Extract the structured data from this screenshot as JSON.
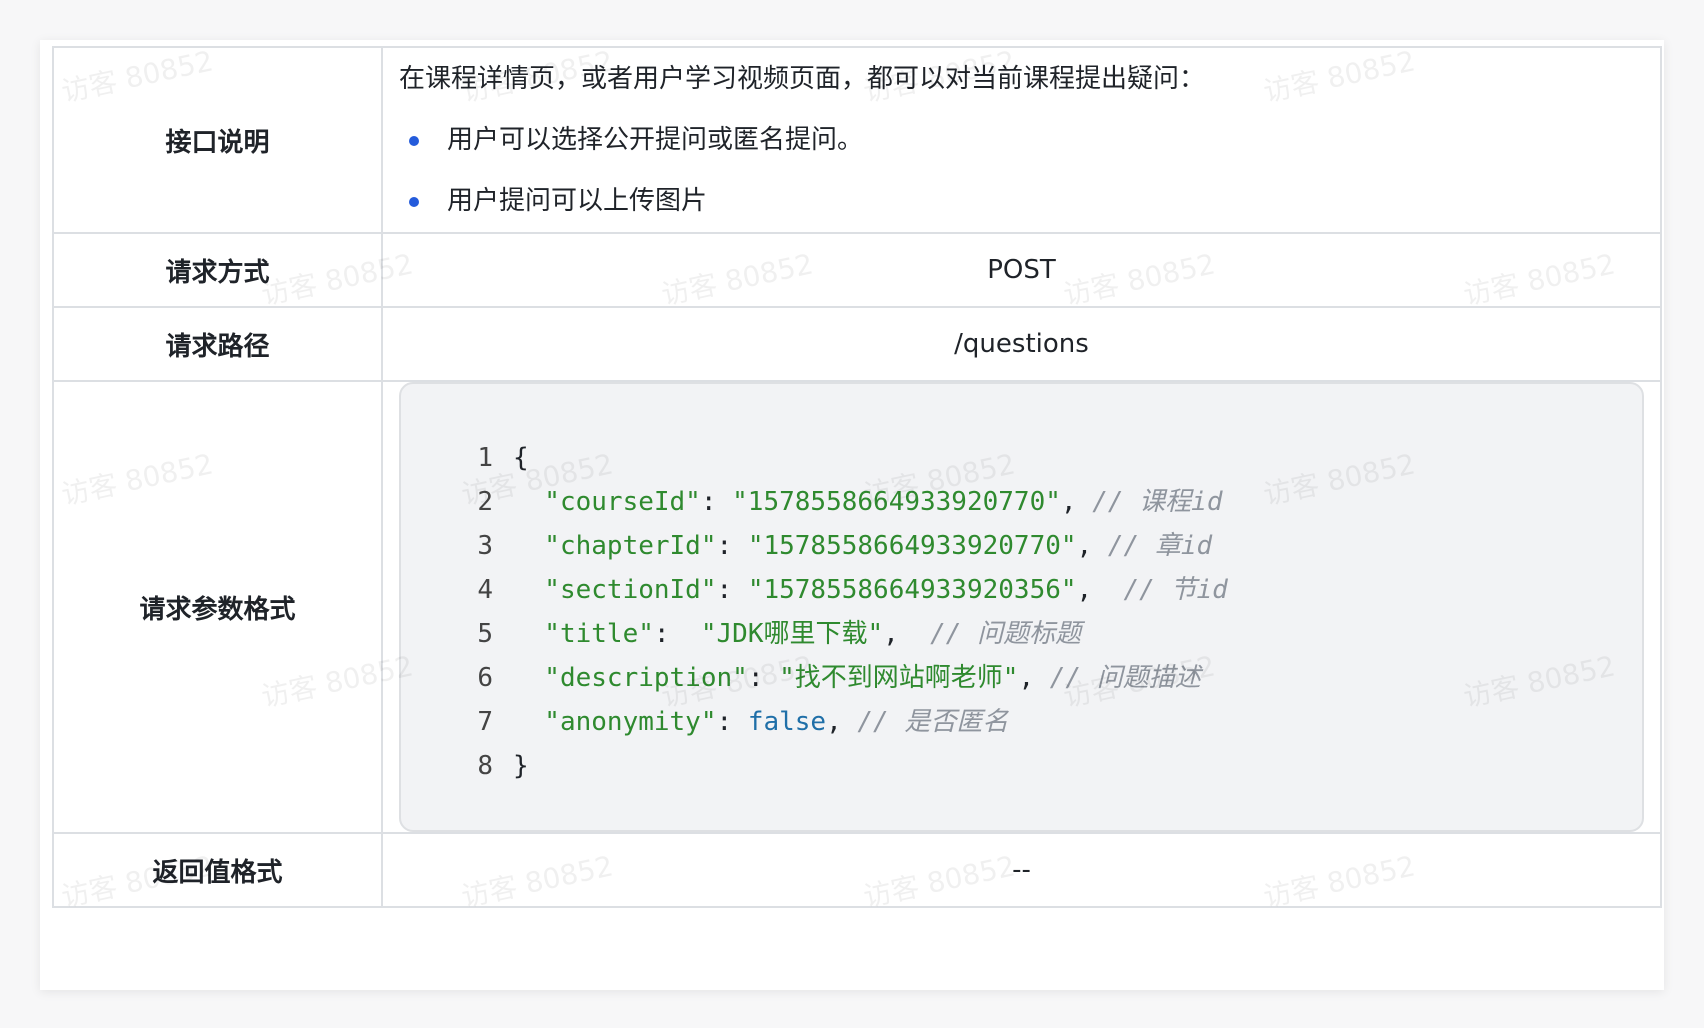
{
  "rows": [
    {
      "label": "接口说明",
      "intro": "在课程详情页，或者用户学习视频页面，都可以对当前课程提出疑问：",
      "bullets": [
        "用户可以选择公开提问或匿名提问。",
        "用户提问可以上传图片"
      ]
    },
    {
      "label": "请求方式",
      "value": "POST"
    },
    {
      "label": "请求路径",
      "value": "/questions"
    },
    {
      "label": "请求参数格式"
    },
    {
      "label": "返回值格式",
      "value": "--"
    }
  ],
  "code": {
    "line_numbers": [
      "1",
      "2",
      "3",
      "4",
      "5",
      "6",
      "7",
      "8"
    ],
    "lines": [
      [
        {
          "t": "{",
          "c": "punct"
        }
      ],
      [
        {
          "t": "  \"courseId\"",
          "c": "str"
        },
        {
          "t": ": ",
          "c": "punct"
        },
        {
          "t": "\"1578558664933920770\"",
          "c": "str"
        },
        {
          "t": ", ",
          "c": "punct"
        },
        {
          "t": "// 课程id",
          "c": "comment"
        }
      ],
      [
        {
          "t": "  \"chapterId\"",
          "c": "str"
        },
        {
          "t": ": ",
          "c": "punct"
        },
        {
          "t": "\"1578558664933920770\"",
          "c": "str"
        },
        {
          "t": ", ",
          "c": "punct"
        },
        {
          "t": "// 章id",
          "c": "comment"
        }
      ],
      [
        {
          "t": "  \"sectionId\"",
          "c": "str"
        },
        {
          "t": ": ",
          "c": "punct"
        },
        {
          "t": "\"1578558664933920356\"",
          "c": "str"
        },
        {
          "t": ",  ",
          "c": "punct"
        },
        {
          "t": "// 节id",
          "c": "comment"
        }
      ],
      [
        {
          "t": "  \"title\"",
          "c": "str"
        },
        {
          "t": ":  ",
          "c": "punct"
        },
        {
          "t": "\"JDK哪里下载\"",
          "c": "str"
        },
        {
          "t": ",  ",
          "c": "punct"
        },
        {
          "t": "// 问题标题",
          "c": "comment"
        }
      ],
      [
        {
          "t": "  \"description\"",
          "c": "str"
        },
        {
          "t": ": ",
          "c": "punct"
        },
        {
          "t": "\"找不到网站啊老师\"",
          "c": "str"
        },
        {
          "t": ", ",
          "c": "punct"
        },
        {
          "t": "// 问题描述",
          "c": "comment"
        }
      ],
      [
        {
          "t": "  \"anonymity\"",
          "c": "str"
        },
        {
          "t": ": ",
          "c": "punct"
        },
        {
          "t": "false",
          "c": "bool"
        },
        {
          "t": ", ",
          "c": "punct"
        },
        {
          "t": "// 是否匿名",
          "c": "comment"
        }
      ],
      [
        {
          "t": "}",
          "c": "punct"
        }
      ]
    ]
  },
  "watermark": "访客 80852",
  "colors": {
    "string": "#2f8a2f",
    "keyword": "#1f6fa8",
    "comment": "#8f959e",
    "bullet": "#245bdb"
  }
}
